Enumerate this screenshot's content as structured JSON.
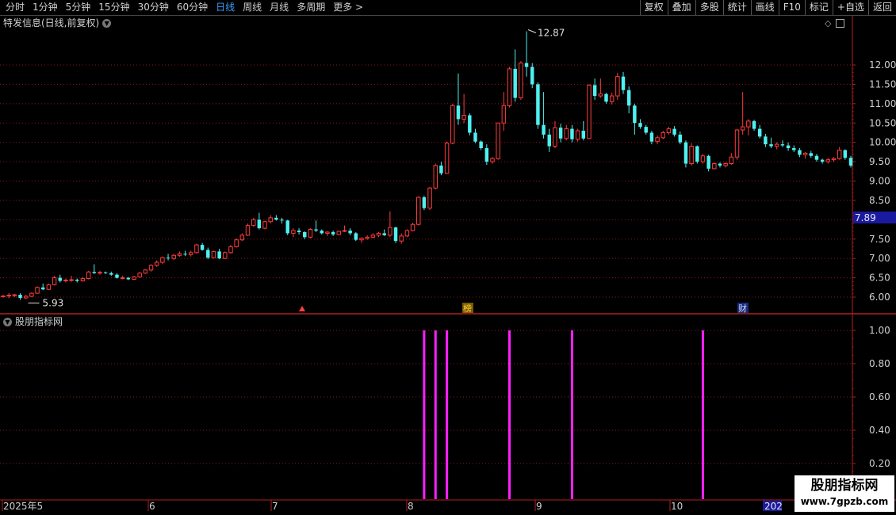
{
  "toolbar": {
    "periods": [
      "分时",
      "1分钟",
      "5分钟",
      "15分钟",
      "30分钟",
      "60分钟",
      "日线",
      "周线",
      "月线",
      "多周期",
      "更多 >"
    ],
    "active_period": "日线",
    "buttons": [
      "复权",
      "叠加",
      "多股",
      "统计",
      "画线",
      "F10",
      "标记",
      "+自选",
      "返回"
    ]
  },
  "main_panel": {
    "title": "特发信息(日线,前复权)",
    "price_high_label": "12.87",
    "price_low_label": "5.93",
    "current_price_label": "7.89",
    "markers": [
      {
        "label": "",
        "type": "triangle",
        "color": "#ff4040"
      },
      {
        "label": "榜",
        "type": "tag",
        "color": "#ffd040"
      },
      {
        "label": "财",
        "type": "tag",
        "color": "#3a6cff"
      }
    ],
    "icons": [
      "diamond-icon",
      "window-icon"
    ]
  },
  "indicator_panel": {
    "title": "股朋指标网"
  },
  "time_axis": {
    "labels": [
      "2025年5",
      "6",
      "7",
      "8",
      "9",
      "10",
      "202"
    ]
  },
  "watermark": {
    "title": "股朋指标网",
    "url": "www.7gpzb.com"
  },
  "colors": {
    "up": "#ff3b3b",
    "down": "#4ff0f0",
    "grid": "#8a1a1a",
    "axis": "#b02020",
    "signal": "#ff20ff",
    "price_box": "#1a1aa0"
  },
  "chart_data": [
    {
      "type": "candlestick",
      "title": "特发信息(日线,前复权)",
      "y_ticks": [
        6.0,
        6.5,
        7.0,
        7.5,
        8.0,
        8.5,
        9.0,
        9.5,
        10.0,
        10.5,
        11.0,
        11.5,
        12.0
      ],
      "ylim": [
        5.75,
        12.95
      ],
      "x_labels": [
        "2025年5",
        "6",
        "7",
        "8",
        "9",
        "10",
        "202"
      ],
      "candles": [
        [
          6.02,
          6.05,
          5.99,
          6.03
        ],
        [
          6.03,
          6.1,
          5.97,
          6.05
        ],
        [
          6.05,
          6.08,
          6.0,
          6.06
        ],
        [
          6.06,
          6.1,
          5.93,
          5.98
        ],
        [
          5.98,
          6.06,
          5.95,
          6.02
        ],
        [
          6.02,
          6.12,
          6.0,
          6.1
        ],
        [
          6.1,
          6.28,
          6.08,
          6.25
        ],
        [
          6.25,
          6.35,
          6.18,
          6.2
        ],
        [
          6.2,
          6.35,
          6.18,
          6.32
        ],
        [
          6.32,
          6.55,
          6.3,
          6.5
        ],
        [
          6.5,
          6.58,
          6.38,
          6.42
        ],
        [
          6.42,
          6.48,
          6.38,
          6.44
        ],
        [
          6.44,
          6.55,
          6.4,
          6.45
        ],
        [
          6.45,
          6.48,
          6.38,
          6.42
        ],
        [
          6.42,
          6.52,
          6.4,
          6.48
        ],
        [
          6.48,
          6.68,
          6.46,
          6.65
        ],
        [
          6.65,
          6.85,
          6.6,
          6.62
        ],
        [
          6.62,
          6.68,
          6.58,
          6.64
        ],
        [
          6.64,
          6.66,
          6.6,
          6.62
        ],
        [
          6.62,
          6.66,
          6.55,
          6.58
        ],
        [
          6.58,
          6.62,
          6.48,
          6.5
        ],
        [
          6.5,
          6.55,
          6.46,
          6.5
        ],
        [
          6.5,
          6.52,
          6.44,
          6.46
        ],
        [
          6.46,
          6.55,
          6.44,
          6.52
        ],
        [
          6.52,
          6.65,
          6.5,
          6.62
        ],
        [
          6.62,
          6.72,
          6.6,
          6.7
        ],
        [
          6.7,
          6.85,
          6.66,
          6.82
        ],
        [
          6.82,
          6.95,
          6.78,
          6.9
        ],
        [
          6.9,
          7.05,
          6.85,
          7.02
        ],
        [
          7.02,
          7.12,
          6.95,
          7.0
        ],
        [
          7.0,
          7.12,
          6.96,
          7.08
        ],
        [
          7.08,
          7.18,
          7.04,
          7.12
        ],
        [
          7.12,
          7.2,
          7.06,
          7.1
        ],
        [
          7.1,
          7.2,
          7.05,
          7.15
        ],
        [
          7.15,
          7.38,
          7.12,
          7.35
        ],
        [
          7.35,
          7.4,
          7.2,
          7.22
        ],
        [
          7.22,
          7.28,
          6.98,
          7.02
        ],
        [
          7.02,
          7.2,
          7.0,
          7.18
        ],
        [
          7.18,
          7.25,
          6.98,
          7.0
        ],
        [
          7.0,
          7.18,
          6.98,
          7.15
        ],
        [
          7.15,
          7.35,
          7.12,
          7.3
        ],
        [
          7.3,
          7.52,
          7.28,
          7.48
        ],
        [
          7.48,
          7.65,
          7.45,
          7.6
        ],
        [
          7.6,
          7.9,
          7.58,
          7.85
        ],
        [
          7.85,
          8.05,
          7.82,
          8.0
        ],
        [
          8.0,
          8.18,
          7.75,
          7.78
        ],
        [
          7.78,
          7.98,
          7.75,
          7.95
        ],
        [
          7.95,
          8.12,
          7.9,
          8.05
        ],
        [
          8.05,
          8.12,
          7.98,
          8.0
        ],
        [
          8.0,
          8.05,
          7.9,
          7.98
        ],
        [
          7.98,
          8.0,
          7.6,
          7.65
        ],
        [
          7.65,
          7.78,
          7.55,
          7.72
        ],
        [
          7.72,
          7.78,
          7.62,
          7.68
        ],
        [
          7.68,
          7.7,
          7.5,
          7.55
        ],
        [
          7.55,
          7.78,
          7.52,
          7.75
        ],
        [
          7.75,
          7.98,
          7.68,
          7.72
        ],
        [
          7.72,
          7.75,
          7.62,
          7.65
        ],
        [
          7.65,
          7.7,
          7.58,
          7.68
        ],
        [
          7.68,
          7.72,
          7.58,
          7.62
        ],
        [
          7.62,
          7.72,
          7.6,
          7.7
        ],
        [
          7.7,
          7.85,
          7.68,
          7.72
        ],
        [
          7.72,
          7.78,
          7.6,
          7.65
        ],
        [
          7.65,
          7.68,
          7.45,
          7.48
        ],
        [
          7.48,
          7.55,
          7.4,
          7.52
        ],
        [
          7.52,
          7.6,
          7.48,
          7.55
        ],
        [
          7.55,
          7.65,
          7.52,
          7.6
        ],
        [
          7.6,
          7.68,
          7.55,
          7.65
        ],
        [
          7.65,
          7.75,
          7.58,
          7.6
        ],
        [
          7.6,
          8.22,
          7.55,
          7.8
        ],
        [
          7.8,
          7.82,
          7.4,
          7.45
        ],
        [
          7.45,
          7.65,
          7.38,
          7.58
        ],
        [
          7.58,
          7.75,
          7.55,
          7.72
        ],
        [
          7.72,
          7.92,
          7.7,
          7.88
        ],
        [
          7.88,
          8.6,
          7.85,
          8.58
        ],
        [
          8.58,
          8.62,
          8.25,
          8.3
        ],
        [
          8.3,
          8.85,
          8.25,
          8.82
        ],
        [
          8.82,
          9.45,
          8.78,
          9.4
        ],
        [
          9.4,
          9.5,
          9.15,
          9.2
        ],
        [
          9.2,
          10.02,
          9.18,
          9.98
        ],
        [
          9.98,
          11.0,
          9.95,
          10.95
        ],
        [
          10.95,
          11.78,
          10.45,
          10.6
        ],
        [
          10.6,
          11.25,
          10.5,
          10.7
        ],
        [
          10.7,
          10.75,
          10.18,
          10.25
        ],
        [
          10.25,
          10.35,
          9.98,
          10.02
        ],
        [
          10.02,
          10.05,
          9.8,
          9.85
        ],
        [
          9.85,
          9.95,
          9.42,
          9.5
        ],
        [
          9.5,
          9.62,
          9.45,
          9.58
        ],
        [
          9.58,
          10.3,
          9.55,
          10.5
        ],
        [
          10.5,
          11.3,
          10.3,
          10.95
        ],
        [
          10.95,
          11.95,
          10.9,
          11.9
        ],
        [
          11.9,
          12.4,
          11.05,
          11.15
        ],
        [
          11.15,
          12.1,
          11.1,
          12.05
        ],
        [
          12.05,
          12.87,
          11.7,
          11.95
        ],
        [
          11.95,
          12.05,
          11.4,
          11.5
        ],
        [
          11.5,
          11.55,
          10.35,
          10.45
        ],
        [
          10.45,
          11.3,
          10.1,
          10.2
        ],
        [
          10.2,
          10.35,
          9.75,
          9.9
        ],
        [
          9.9,
          10.55,
          9.85,
          10.38
        ],
        [
          10.38,
          10.48,
          10.0,
          10.1
        ],
        [
          10.1,
          10.45,
          10.05,
          10.35
        ],
        [
          10.35,
          10.45,
          10.0,
          10.08
        ],
        [
          10.08,
          10.35,
          10.02,
          10.3
        ],
        [
          10.3,
          10.55,
          10.05,
          10.1
        ],
        [
          10.1,
          11.5,
          10.08,
          11.48
        ],
        [
          11.48,
          11.65,
          11.1,
          11.2
        ],
        [
          11.2,
          11.65,
          11.15,
          11.25
        ],
        [
          11.25,
          11.28,
          11.0,
          11.05
        ],
        [
          11.05,
          11.28,
          10.98,
          11.2
        ],
        [
          11.2,
          11.8,
          11.1,
          11.7
        ],
        [
          11.7,
          11.82,
          11.25,
          11.35
        ],
        [
          11.35,
          11.45,
          10.75,
          10.95
        ],
        [
          10.95,
          11.0,
          10.2,
          10.5
        ],
        [
          10.5,
          10.6,
          10.35,
          10.4
        ],
        [
          10.4,
          10.45,
          10.2,
          10.25
        ],
        [
          10.25,
          10.3,
          9.95,
          10.02
        ],
        [
          10.02,
          10.18,
          9.95,
          10.12
        ],
        [
          10.12,
          10.3,
          10.08,
          10.25
        ],
        [
          10.25,
          10.4,
          10.2,
          10.35
        ],
        [
          10.35,
          10.42,
          10.15,
          10.2
        ],
        [
          10.2,
          10.28,
          9.95,
          10.0
        ],
        [
          10.0,
          10.05,
          9.35,
          9.45
        ],
        [
          9.45,
          9.98,
          9.4,
          9.9
        ],
        [
          9.9,
          9.92,
          9.45,
          9.5
        ],
        [
          9.5,
          9.7,
          9.45,
          9.65
        ],
        [
          9.65,
          9.68,
          9.25,
          9.32
        ],
        [
          9.32,
          9.48,
          9.3,
          9.45
        ],
        [
          9.45,
          9.48,
          9.35,
          9.4
        ],
        [
          9.4,
          9.48,
          9.35,
          9.45
        ],
        [
          9.45,
          9.72,
          9.42,
          9.62
        ],
        [
          9.62,
          10.35,
          9.55,
          10.32
        ],
        [
          10.32,
          11.3,
          10.2,
          10.4
        ],
        [
          10.4,
          10.6,
          10.18,
          10.55
        ],
        [
          10.55,
          10.58,
          10.3,
          10.35
        ],
        [
          10.35,
          10.45,
          10.1,
          10.15
        ],
        [
          10.15,
          10.22,
          9.88,
          9.95
        ],
        [
          9.95,
          10.12,
          9.85,
          9.9
        ],
        [
          9.9,
          10.0,
          9.82,
          9.95
        ],
        [
          9.95,
          10.05,
          9.88,
          9.92
        ],
        [
          9.92,
          10.0,
          9.78,
          9.85
        ],
        [
          9.85,
          9.92,
          9.75,
          9.8
        ],
        [
          9.8,
          9.85,
          9.62,
          9.68
        ],
        [
          9.68,
          9.75,
          9.58,
          9.72
        ],
        [
          9.72,
          9.78,
          9.6,
          9.65
        ],
        [
          9.65,
          9.7,
          9.5,
          9.55
        ],
        [
          9.55,
          9.58,
          9.45,
          9.5
        ],
        [
          9.5,
          9.6,
          9.45,
          9.55
        ],
        [
          9.55,
          9.62,
          9.5,
          9.58
        ],
        [
          9.58,
          9.88,
          9.55,
          9.8
        ],
        [
          9.8,
          9.82,
          9.55,
          9.6
        ],
        [
          9.6,
          9.65,
          9.35,
          9.4
        ]
      ]
    },
    {
      "type": "bar",
      "title": "股朋指标网",
      "y_ticks": [
        0.2,
        0.4,
        0.6,
        0.8,
        1.0
      ],
      "ylim": [
        0,
        1.05
      ],
      "signals": [
        {
          "index": 74,
          "value": 1.0
        },
        {
          "index": 76,
          "value": 1.0
        },
        {
          "index": 78,
          "value": 1.0
        },
        {
          "index": 89,
          "value": 1.0
        },
        {
          "index": 100,
          "value": 1.0
        },
        {
          "index": 123,
          "value": 1.0
        }
      ]
    }
  ]
}
